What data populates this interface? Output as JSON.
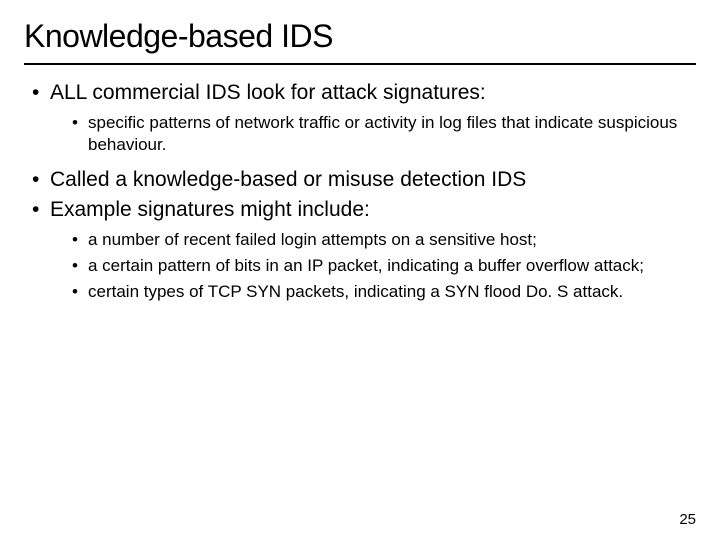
{
  "title": "Knowledge-based IDS",
  "bullets": {
    "b0": "ALL commercial IDS look for attack signatures:",
    "b0_sub0": "specific patterns of network traffic or activity in log files that indicate suspicious behaviour.",
    "b1": "Called a knowledge-based or misuse detection IDS",
    "b2": "Example signatures might include:",
    "b2_sub0": "a number of recent failed login attempts on a sensitive host;",
    "b2_sub1": "a certain pattern of bits in an IP packet, indicating a buffer overflow attack;",
    "b2_sub2": "certain types of TCP SYN packets, indicating a SYN flood Do. S attack."
  },
  "page_number": "25"
}
